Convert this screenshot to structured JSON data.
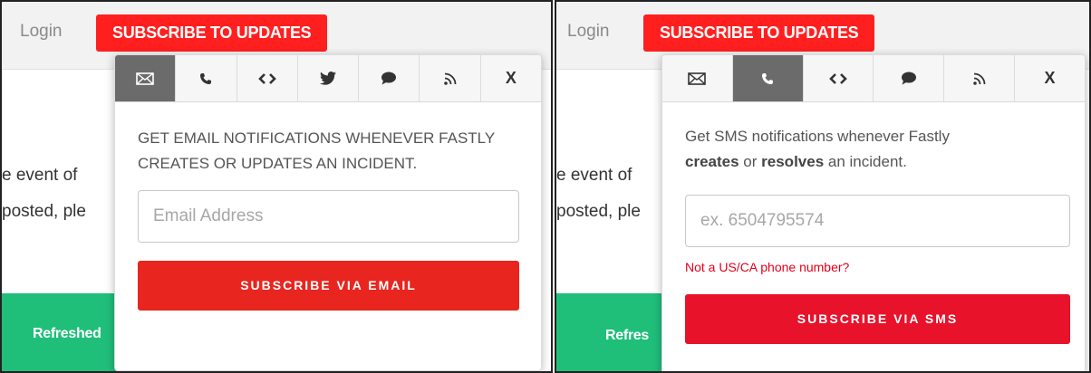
{
  "left": {
    "login": "Login",
    "subscribe_button": "SUBSCRIBE TO UPDATES",
    "bg_line1": "e event of",
    "bg_line2": "posted, ple",
    "green_text": "Refreshed",
    "tabs": [
      {
        "name": "email",
        "icon": "envelope-icon",
        "active": true
      },
      {
        "name": "sms",
        "icon": "phone-icon",
        "active": false
      },
      {
        "name": "webhook",
        "icon": "code-icon",
        "active": false
      },
      {
        "name": "twitter",
        "icon": "twitter-icon",
        "active": false
      },
      {
        "name": "chat",
        "icon": "chat-bubble-icon",
        "active": false
      },
      {
        "name": "rss",
        "icon": "rss-icon",
        "active": false
      },
      {
        "name": "close",
        "label": "X",
        "active": false
      }
    ],
    "description": "GET EMAIL NOTIFICATIONS WHENEVER FASTLY CREATES OR UPDATES AN INCIDENT.",
    "email_placeholder": "Email Address",
    "email_value": "",
    "submit_label": "SUBSCRIBE VIA EMAIL"
  },
  "right": {
    "login": "Login",
    "subscribe_button": "SUBSCRIBE TO UPDATES",
    "bg_line1": "e event of",
    "bg_line2": "posted, ple",
    "green_text": "Refres",
    "tabs": [
      {
        "name": "email",
        "icon": "envelope-icon",
        "active": false
      },
      {
        "name": "sms",
        "icon": "phone-icon",
        "active": true
      },
      {
        "name": "webhook",
        "icon": "code-icon",
        "active": false
      },
      {
        "name": "chat",
        "icon": "chat-bubble-icon",
        "active": false
      },
      {
        "name": "rss",
        "icon": "rss-icon",
        "active": false
      },
      {
        "name": "close",
        "label": "X",
        "active": false
      }
    ],
    "description_prefix": "Get SMS notifications whenever Fastly",
    "description_bold1": "creates",
    "description_mid": "or",
    "description_bold2": "resolves",
    "description_suffix": "an incident.",
    "phone_placeholder": "ex. 6504795574",
    "phone_value": "",
    "phone_hint": "Not a US/CA phone number?",
    "submit_label": "SUBSCRIBE VIA SMS"
  },
  "colors": {
    "subscribe_red": "#ff1f1f",
    "email_button": "#e8251f",
    "sms_button": "#e8122b",
    "green": "#1fbf7a",
    "active_tab": "#6b6b6b"
  }
}
